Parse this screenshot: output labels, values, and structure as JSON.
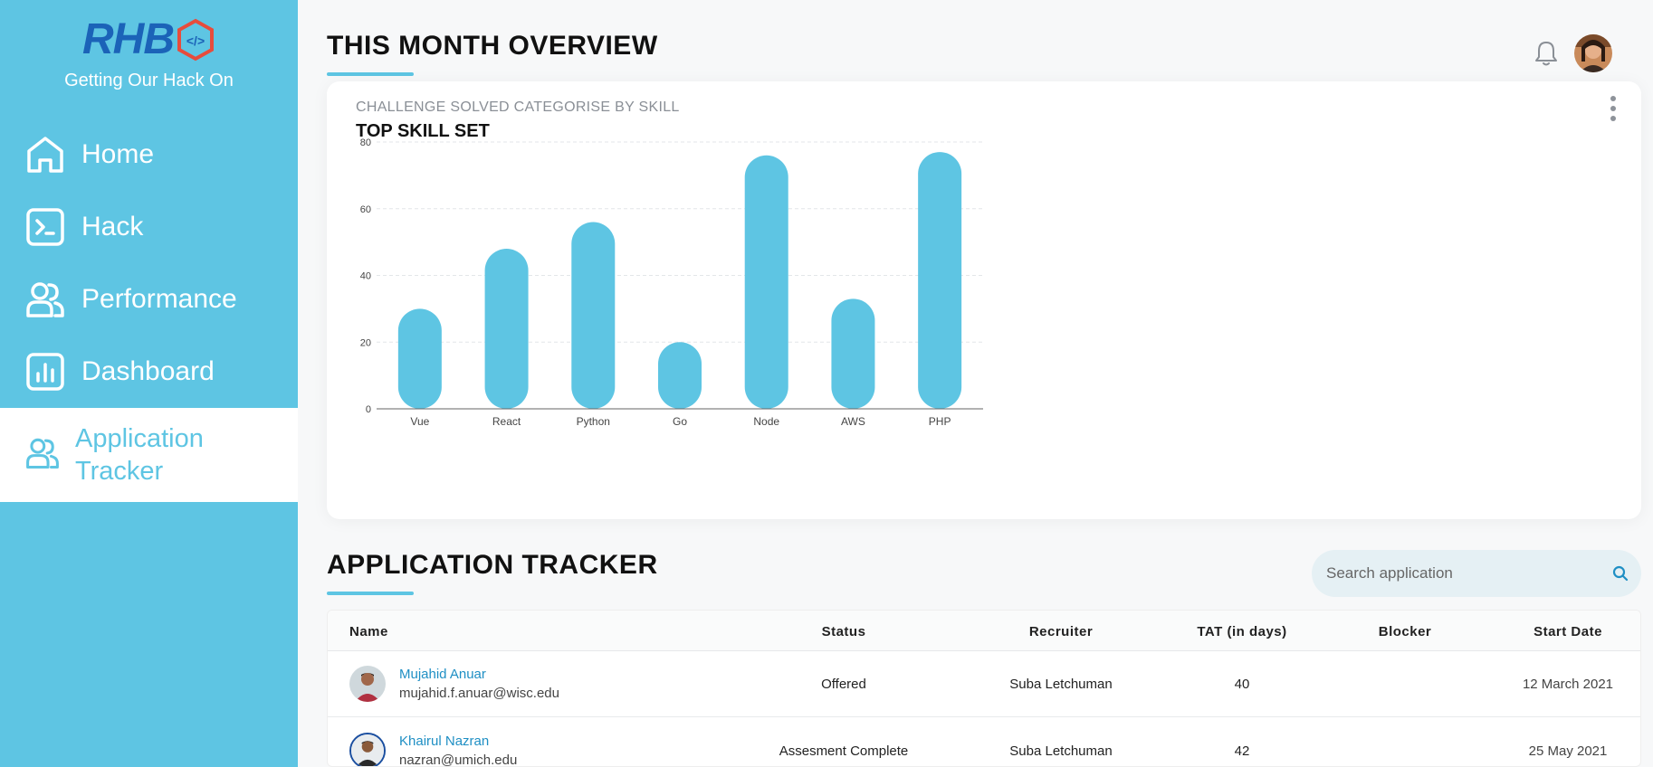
{
  "brand": {
    "logo_text": "RHB",
    "tagline": "Getting Our Hack On",
    "logo_color": "#1b63b8",
    "logo_accent": "#e74c3c"
  },
  "sidebar": {
    "items": [
      {
        "label": "Home",
        "icon": "home-icon"
      },
      {
        "label": "Hack",
        "icon": "terminal-icon"
      },
      {
        "label": "Performance",
        "icon": "users-icon"
      },
      {
        "label": "Dashboard",
        "icon": "bar-chart-icon"
      },
      {
        "label": "Application Tracker",
        "icon": "users-icon",
        "active": true
      }
    ]
  },
  "overview": {
    "title": "THIS MONTH OVERVIEW",
    "card_subtitle": "CHALLENGE SOLVED CATEGORISE BY SKILL",
    "card_title": "TOP SKILL SET"
  },
  "chart_data": {
    "type": "bar",
    "categories": [
      "Vue",
      "React",
      "Python",
      "Go",
      "Node",
      "AWS",
      "PHP"
    ],
    "values": [
      30,
      48,
      56,
      20,
      76,
      33,
      77
    ],
    "ylim": [
      0,
      80
    ],
    "yticks": [
      0,
      20,
      40,
      60,
      80
    ],
    "grid": true,
    "bar_color": "#5ec5e3"
  },
  "tracker": {
    "title": "APPLICATION TRACKER",
    "search_placeholder": "Search application",
    "columns": [
      "Name",
      "Status",
      "Recruiter",
      "TAT (in days)",
      "Blocker",
      "Start Date"
    ],
    "rows": [
      {
        "name": "Mujahid Anuar",
        "email": "mujahid.f.anuar@wisc.edu",
        "status": "Offered",
        "recruiter": "Suba Letchuman",
        "tat": "40",
        "blocker": "",
        "start_date": "12 March 2021"
      },
      {
        "name": "Khairul Nazran",
        "email": "nazran@umich.edu",
        "status": "Assesment Complete",
        "recruiter": "Suba Letchuman",
        "tat": "42",
        "blocker": "",
        "start_date": "25 May 2021"
      }
    ]
  },
  "colors": {
    "accent": "#5ec5e3",
    "link": "#1f8fc4"
  }
}
